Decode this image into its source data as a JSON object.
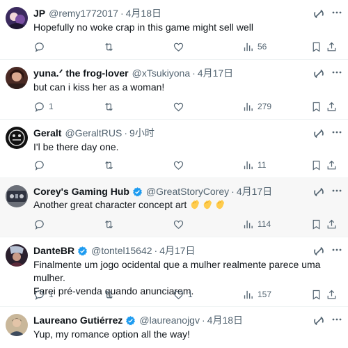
{
  "tweets": [
    {
      "name": "JP",
      "handle": "@remy1772017",
      "time": "4月18日",
      "verified": false,
      "text": "Hopefully no woke crap in this game might sell well",
      "extra_text": "",
      "replies": "",
      "retweets": "",
      "likes": "",
      "views": "56",
      "avatar_color": "#3b2a5e"
    },
    {
      "name": "yuna.ᐟ the frog-lover",
      "handle": "@xTsukiyona",
      "time": "4月17日",
      "verified": false,
      "text": "but can i kiss her as a woman!",
      "extra_text": "",
      "replies": "1",
      "retweets": "",
      "likes": "",
      "views": "279",
      "avatar_color": "#4a2a24"
    },
    {
      "name": "Geralt",
      "handle": "@GeraltRUS",
      "time": "9小时",
      "verified": false,
      "text": "I'l be there day one.",
      "extra_text": "",
      "replies": "",
      "retweets": "",
      "likes": "",
      "views": "11",
      "avatar_color": "#111111"
    },
    {
      "name": "Corey's Gaming Hub",
      "handle": "@GreatStoryCorey",
      "time": "4月17日",
      "verified": true,
      "text": "Another great character concept art",
      "extra_text": "",
      "replies": "",
      "retweets": "",
      "likes": "",
      "views": "114",
      "avatar_color": "#6b6f78"
    },
    {
      "name": "DanteBR",
      "handle": "@tontel15642",
      "time": "4月17日",
      "verified": true,
      "text": "Finalmente um jogo ocidental que a mulher realmente parece uma mulher.",
      "extra_text": "Farei pré-venda quando anunciarem.",
      "replies": "1",
      "retweets": "",
      "likes": "1",
      "views": "157",
      "avatar_color": "#2a1f2d"
    },
    {
      "name": "Laureano Gutiérrez",
      "handle": "@laureanojgv",
      "time": "4月18日",
      "verified": true,
      "text": "Yup, my romance option all the way!",
      "extra_text": "",
      "replies": "",
      "retweets": "",
      "likes": "",
      "views": "",
      "avatar_color": "#c9b79a"
    }
  ],
  "colors": {
    "accent": "#1d9bf0",
    "muted": "#536471",
    "divider": "#eff3f4",
    "highlight": "#f7f7f7"
  },
  "icons": [
    "grok-icon",
    "more-icon",
    "reply-icon",
    "retweet-icon",
    "like-icon",
    "views-icon",
    "bookmark-icon",
    "share-icon",
    "verified-badge-icon",
    "clapping-hands-emoji"
  ]
}
